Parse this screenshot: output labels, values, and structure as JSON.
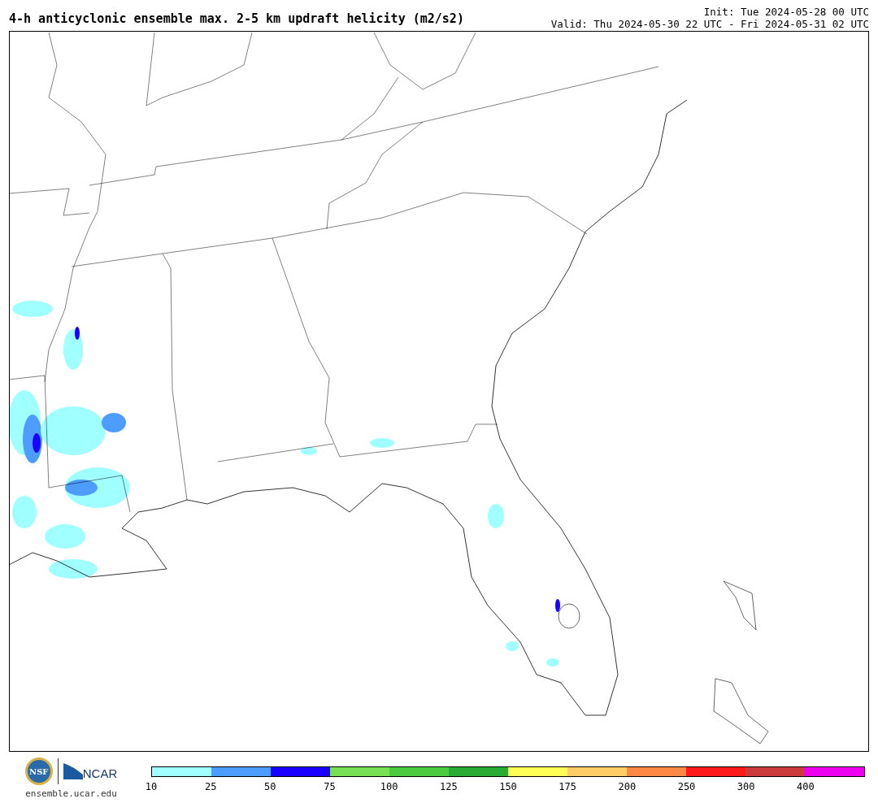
{
  "title": "4-h anticyclonic ensemble max. 2-5 km updraft helicity (m2/s2)",
  "init": "Init: Tue 2024-05-28 00 UTC",
  "valid": "Valid: Thu 2024-05-30 22 UTC - Fri 2024-05-31 02 UTC",
  "logos": {
    "nsf": "NSF",
    "ncar": "NCAR",
    "url": "ensemble.ucar.edu"
  },
  "colorbar": {
    "segments": [
      {
        "color": "#a0ffff"
      },
      {
        "color": "#4d9cff"
      },
      {
        "color": "#1a00ff"
      },
      {
        "color": "#77e055"
      },
      {
        "color": "#4ccb3f"
      },
      {
        "color": "#2aab33"
      },
      {
        "color": "#ffff55"
      },
      {
        "color": "#ffcc66"
      },
      {
        "color": "#ff8844"
      },
      {
        "color": "#ff1a1a"
      },
      {
        "color": "#cc3b3b"
      },
      {
        "color": "#ee00ee"
      }
    ],
    "labels": [
      "10",
      "25",
      "50",
      "75",
      "100",
      "125",
      "150",
      "175",
      "200",
      "250",
      "300",
      "400"
    ]
  }
}
